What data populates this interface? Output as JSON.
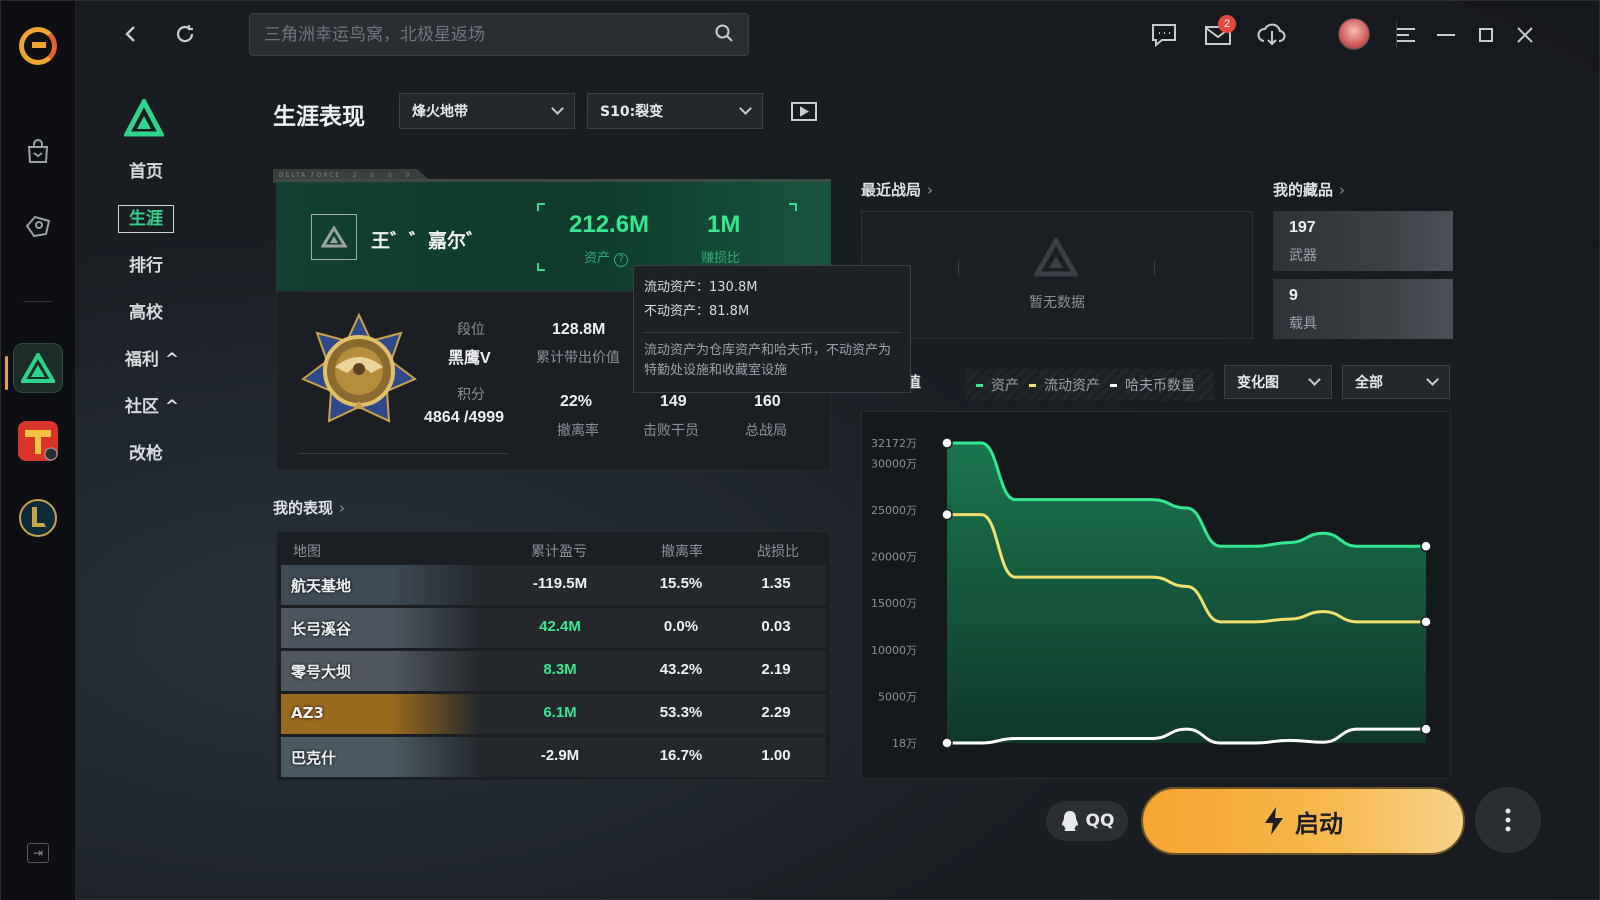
{
  "search": {
    "placeholder": "三角洲幸运鸟窝，北极星返场"
  },
  "top": {
    "badge_count": "2"
  },
  "subnav": {
    "items": [
      {
        "label": "首页"
      },
      {
        "label": "生涯"
      },
      {
        "label": "排行"
      },
      {
        "label": "高校"
      },
      {
        "label": "福利 ^"
      },
      {
        "label": "社区 ^"
      },
      {
        "label": "改枪"
      }
    ]
  },
  "page": {
    "title": "生涯表现",
    "mode_select": "烽火地带",
    "season_select": "S10:裂变"
  },
  "profile": {
    "tab_text": "DELTA FORCE · 2 · 0 · 0 · 0",
    "name": "王゛゛嘉尔゛",
    "assets_value": "212.6M",
    "assets_label": "资产",
    "ratio_value": "1M",
    "ratio_label": "赚损比",
    "rank_label": "段位",
    "rank_value": "黑鹰V",
    "score_label": "积分",
    "score_value": "4864 /4999",
    "stats": [
      {
        "value": "128.8M",
        "label": "累计带出价值"
      },
      {
        "value": "22%",
        "label": "撤离率"
      },
      {
        "value": "149",
        "label": "击败干员"
      },
      {
        "value": "160",
        "label": "总战局"
      }
    ]
  },
  "tooltip": {
    "liquid": "流动资产：130.8M",
    "fixed": "不动资产：81.8M",
    "desc": "流动资产为仓库资产和哈夫币，不动资产为特勤处设施和收藏室设施"
  },
  "recent": {
    "title": "最近战局",
    "empty": "暂无数据"
  },
  "collection": {
    "title": "我的藏品",
    "items": [
      {
        "count": "197",
        "label": "武器"
      },
      {
        "count": "9",
        "label": "载具"
      }
    ]
  },
  "performance": {
    "title": "我的表现",
    "headers": [
      "地图",
      "累计盈亏",
      "撤离率",
      "战损比"
    ],
    "rows": [
      {
        "map": "航天基地",
        "profit": "-119.5M",
        "rate": "15.5%",
        "kd": "1.35",
        "positive": false
      },
      {
        "map": "长弓溪谷",
        "profit": "42.4M",
        "rate": "0.0%",
        "kd": "0.03",
        "positive": true
      },
      {
        "map": "零号大坝",
        "profit": "8.3M",
        "rate": "43.2%",
        "kd": "2.19",
        "positive": true
      },
      {
        "map": "AZ3",
        "profit": "6.1M",
        "rate": "53.3%",
        "kd": "2.29",
        "positive": true
      },
      {
        "map": "巴克什",
        "profit": "-2.9M",
        "rate": "16.7%",
        "kd": "1.00",
        "positive": false
      }
    ]
  },
  "asset_chart": {
    "title_visible": "值",
    "view_select": "变化图",
    "range_select": "全部"
  },
  "chart_data": {
    "type": "area",
    "legend": [
      "资产",
      "流动资产",
      "哈夫币数量"
    ],
    "y_ticks": [
      "32172万",
      "30000万",
      "25000万",
      "20000万",
      "15000万",
      "10000万",
      "5000万",
      "18万"
    ],
    "ylim": [
      18,
      32172
    ],
    "series": [
      {
        "name": "资产",
        "color": "#35e88f",
        "values": [
          32172,
          32172,
          26100,
          26100,
          26100,
          26100,
          26100,
          25200,
          21100,
          21100,
          21500,
          22500,
          21100,
          21100,
          21100
        ]
      },
      {
        "name": "流动资产",
        "color": "#f0e070",
        "values": [
          24500,
          24500,
          17800,
          17800,
          17800,
          17800,
          17800,
          16800,
          13000,
          13000,
          13300,
          14100,
          13000,
          13000,
          13000
        ]
      },
      {
        "name": "哈夫币数量",
        "color": "#ffffff",
        "values": [
          18,
          18,
          500,
          500,
          500,
          500,
          500,
          1500,
          18,
          18,
          300,
          100,
          1500,
          1500,
          1500
        ]
      }
    ]
  },
  "bottom": {
    "qq_label": "QQ",
    "start_label": "启动"
  },
  "colors": {
    "accent": "#35e88f",
    "start_button": "#f5a532",
    "badge": "#e5483e"
  }
}
